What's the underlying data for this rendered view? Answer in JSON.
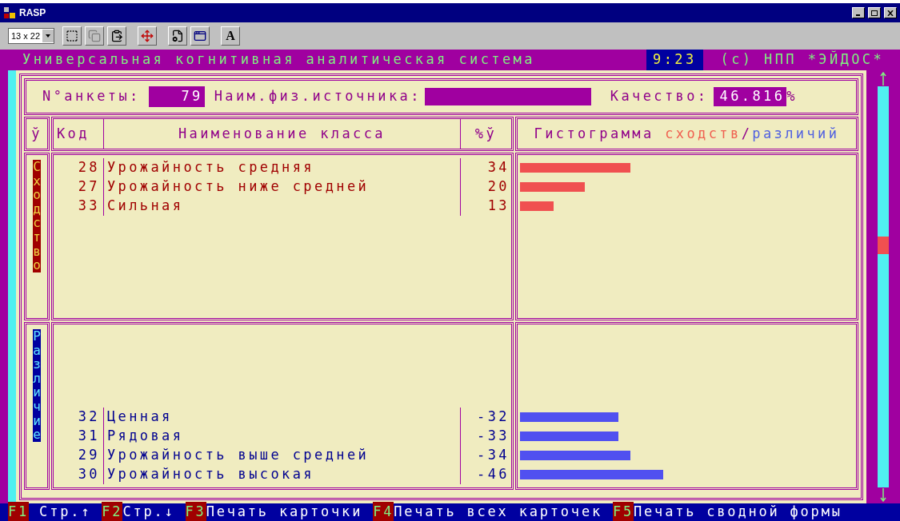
{
  "window": {
    "title": "RASP"
  },
  "toolbar": {
    "font_size": "13 x 22",
    "font_button": "A"
  },
  "header": {
    "title": "Универсальная когнитивная аналитическая система",
    "time": "9:23",
    "copyright": "(c) НПП *ЭЙДОС*"
  },
  "form": {
    "anketa_label": "N°анкеты:",
    "anketa_value": "79",
    "source_label": "Наим.физ.источника:",
    "quality_label": "Качество:",
    "quality_value": "46.816",
    "quality_unit": "%"
  },
  "table": {
    "columns": [
      "ў",
      "Код",
      "Наименование класса",
      "%ў"
    ],
    "histogram_heading": [
      {
        "text": "Гистограмма ",
        "kind": "plain"
      },
      {
        "text": "сходств",
        "kind": "similar"
      },
      {
        "text": "/",
        "kind": "plain"
      },
      {
        "text": "различий",
        "kind": "different"
      }
    ],
    "sections": [
      {
        "label": "Сходство",
        "kind": "similar",
        "rows": [
          {
            "code": "28",
            "name": "Урожайность средняя",
            "percent": "34",
            "level": 0.33
          },
          {
            "code": "27",
            "name": "Урожайность ниже средней",
            "percent": "20",
            "level": 0.195
          },
          {
            "code": "33",
            "name": "Сильная",
            "percent": "13",
            "level": 0.1
          }
        ]
      },
      {
        "label": "Различие",
        "kind": "different",
        "rows": [
          {
            "code": "32",
            "name": "Ценная",
            "percent": "-32",
            "level": 0.296
          },
          {
            "code": "31",
            "name": "Рядовая",
            "percent": "-33",
            "level": 0.296
          },
          {
            "code": "29",
            "name": "Урожайность выше средней",
            "percent": "-34",
            "level": 0.33
          },
          {
            "code": "30",
            "name": "Урожайность высокая",
            "percent": "-46",
            "level": 0.43
          }
        ]
      }
    ]
  },
  "function_keys": [
    {
      "key": "F1",
      "label": " Стр.↑"
    },
    {
      "key": "F2",
      "label": "Стр.↓"
    },
    {
      "key": "F3",
      "label": "Печать карточки"
    },
    {
      "key": "F4",
      "label": "Печать всех карточек"
    },
    {
      "key": "F5",
      "label": "Печать сводной формы"
    }
  ]
}
